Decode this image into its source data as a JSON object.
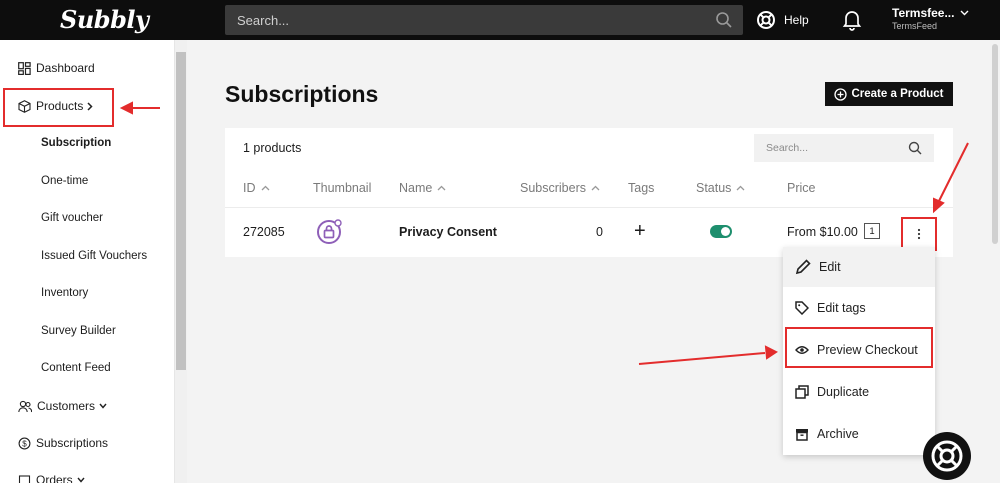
{
  "app": {
    "logo": "Subbly"
  },
  "topbar": {
    "search_placeholder": "Search...",
    "help_label": "Help",
    "account_name": "Termsfee...",
    "account_org": "TermsFeed"
  },
  "sidebar": {
    "dashboard": "Dashboard",
    "products": "Products",
    "sub_items": [
      "Subscription",
      "One-time",
      "Gift voucher",
      "Issued Gift Vouchers",
      "Inventory",
      "Survey Builder",
      "Content Feed"
    ],
    "customers": "Customers",
    "subscriptions": "Subscriptions",
    "orders": "Orders"
  },
  "main": {
    "title": "Subscriptions",
    "create_button": "Create a Product",
    "count_label": "1 products",
    "table_search_placeholder": "Search...",
    "columns": [
      "ID",
      "Thumbnail",
      "Name",
      "Subscribers",
      "Tags",
      "Status",
      "Price"
    ],
    "rows": [
      {
        "id": "272085",
        "name": "Privacy Consent",
        "subscribers": "0",
        "tags": "+",
        "status": "on",
        "price": "From $10.00",
        "price_badge": "1"
      }
    ]
  },
  "dropdown": {
    "items": [
      "Edit",
      "Edit tags",
      "Preview Checkout",
      "Duplicate",
      "Archive"
    ],
    "highlighted": "Preview Checkout"
  },
  "colors": {
    "accent_red": "#e32c2c",
    "toggle_green": "#1e8f6e",
    "thumb_purple": "#8e5fb8"
  }
}
